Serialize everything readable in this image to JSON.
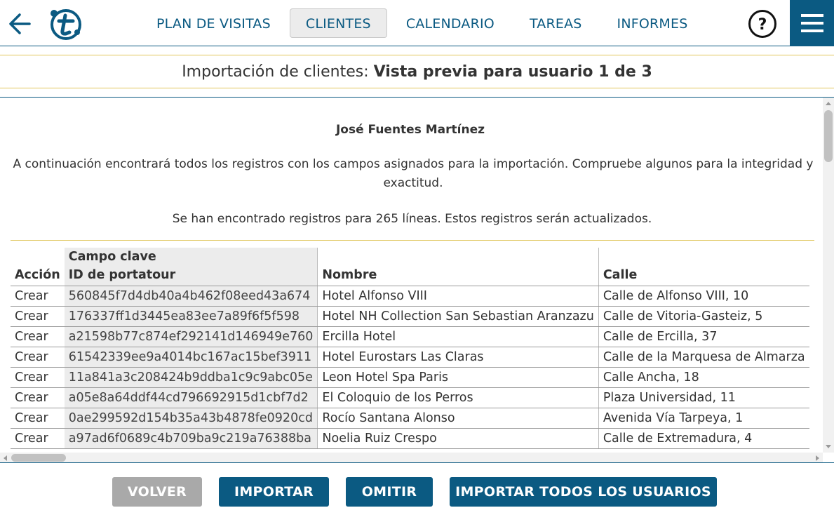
{
  "nav": {
    "items": [
      {
        "label": "PLAN DE VISITAS",
        "active": false
      },
      {
        "label": "CLIENTES",
        "active": true
      },
      {
        "label": "CALENDARIO",
        "active": false
      },
      {
        "label": "TAREAS",
        "active": false
      },
      {
        "label": "INFORMES",
        "active": false
      }
    ],
    "help_label": "?"
  },
  "title": {
    "prefix": "Importación de clientes: ",
    "bold": "Vista previa para usuario 1 de 3"
  },
  "content": {
    "person": "José Fuentes Martínez",
    "intro": "A continuación encontrará todos los registros con los campos asignados para la importación. Compruebe algunos para la integridad y exactitud.",
    "found": "Se han encontrado registros para 265 líneas. Estos registros serán actualizados."
  },
  "table": {
    "headers": {
      "accion": "Acción",
      "key_group": "Campo clave",
      "key": "ID de portatour",
      "nombre": "Nombre",
      "calle": "Calle"
    },
    "rows": [
      {
        "accion": "Crear",
        "key": "560845f7d4db40a4b462f08eed43a674",
        "nombre": "Hotel Alfonso VIII",
        "calle": "Calle de Alfonso VIII, 10"
      },
      {
        "accion": "Crear",
        "key": "176337ff1d3445ea83ee7a89f6f5f598",
        "nombre": "Hotel NH Collection San Sebastian Aranzazu",
        "calle": "Calle de Vitoria-Gasteiz, 5"
      },
      {
        "accion": "Crear",
        "key": "a21598b77c874ef292141d146949e760",
        "nombre": "Ercilla Hotel",
        "calle": "Calle de Ercilla, 37"
      },
      {
        "accion": "Crear",
        "key": "61542339ee9a4014bc167ac15bef3911",
        "nombre": "Hotel Eurostars Las Claras",
        "calle": "Calle de la Marquesa de Almarza"
      },
      {
        "accion": "Crear",
        "key": "11a841a3c208424b9ddba1c9c9abc05e",
        "nombre": "Leon Hotel Spa Paris",
        "calle": "Calle Ancha, 18"
      },
      {
        "accion": "Crear",
        "key": "a05e8a64ddf44cd796692915d1cbf7d2",
        "nombre": "El Coloquio de los Perros",
        "calle": "Plaza Universidad, 11"
      },
      {
        "accion": "Crear",
        "key": "0ae299592d154b35a43b4878fe0920cd",
        "nombre": "Rocío Santana Alonso",
        "calle": "Avenida Vía Tarpeya, 1"
      },
      {
        "accion": "Crear",
        "key": "a97ad6f0689c4b709ba9c219a76388ba",
        "nombre": "Noelia Ruiz Crespo",
        "calle": "Calle de Extremadura, 4"
      }
    ]
  },
  "footer": {
    "volver": "VOLVER",
    "importar": "IMPORTAR",
    "omitir": "OMITIR",
    "importar_todos": "IMPORTAR TODOS LOS USUARIOS"
  },
  "colors": {
    "brand": "#0b5a82",
    "accent_line": "#e0c65a",
    "disabled": "#a9a9a9"
  },
  "icons": [
    "back-arrow-icon",
    "portatour-logo",
    "help-icon",
    "hamburger-menu-icon"
  ]
}
